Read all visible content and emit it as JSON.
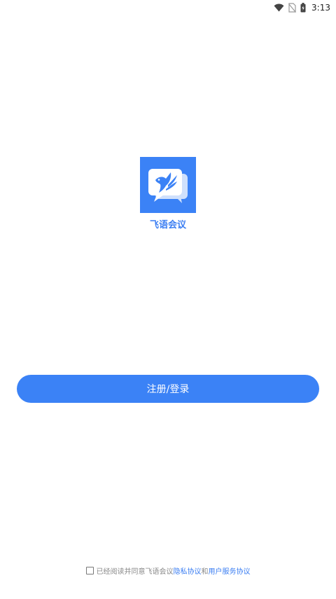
{
  "status_bar": {
    "time": "3:13",
    "icons": [
      "wifi-icon",
      "no-sim-icon",
      "battery-icon"
    ]
  },
  "app": {
    "name": "飞语会议",
    "logo_icon": "chat-bird-logo-icon",
    "brand_color": "#3b82f6"
  },
  "actions": {
    "login_label": "注册/登录"
  },
  "agreement": {
    "prefix": "已经阅读并同意飞语会议",
    "privacy_link": "隐私协议",
    "conjunction": "和",
    "service_link": "用户服务协议",
    "checked": false
  }
}
